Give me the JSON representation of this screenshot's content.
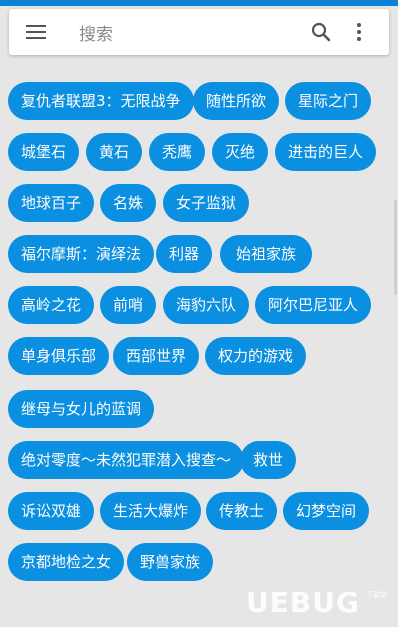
{
  "search": {
    "placeholder": "搜索"
  },
  "tags": [
    [
      "复仇者联盟3：无限战争",
      "随性所欲",
      "星际之门"
    ],
    [
      "城堡石",
      "黄石",
      "秃鹰",
      "灭绝",
      "进击的巨人"
    ],
    [
      "地球百子",
      "名姝",
      "女子监狱"
    ],
    [
      "福尔摩斯：演绎法",
      "利器",
      "始祖家族"
    ],
    [
      "高岭之花",
      "前哨",
      "海豹六队",
      "阿尔巴尼亚人"
    ],
    [
      "单身俱乐部",
      "西部世界",
      "权力的游戏"
    ],
    [
      "继母与女儿的蓝调"
    ],
    [
      "绝对零度～未然犯罪潜入搜查～",
      "救世"
    ],
    [
      "诉讼双雄",
      "生活大爆炸",
      "传教士",
      "幻梦空间"
    ],
    [
      "京都地检之女",
      "野兽家族"
    ]
  ],
  "colors": {
    "tag_bg": "#0b8fe0",
    "tag_text": "#ffffff",
    "page_bg": "#e6e6e6"
  },
  "icons": {
    "menu": "menu-icon",
    "search": "search-icon",
    "more": "more-vertical-icon"
  },
  "watermark": {
    "text": "UEBUG",
    "small_text": "下载站"
  }
}
